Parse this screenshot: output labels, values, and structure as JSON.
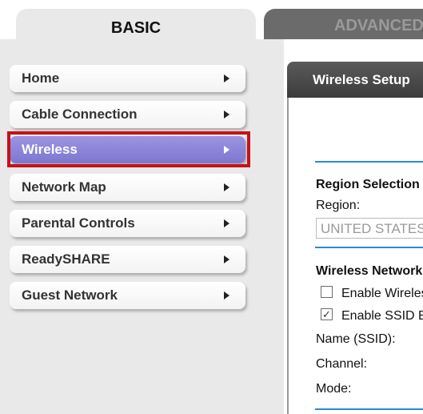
{
  "tabs": {
    "basic": "BASIC",
    "advanced": "ADVANCED"
  },
  "nav": [
    {
      "label": "Home"
    },
    {
      "label": "Cable Connection"
    },
    {
      "label": "Wireless"
    },
    {
      "label": "Network Map"
    },
    {
      "label": "Parental Controls"
    },
    {
      "label": "ReadySHARE"
    },
    {
      "label": "Guest Network"
    }
  ],
  "active_nav": "Wireless",
  "panel": {
    "title": "Wireless Setup",
    "region_section": "Region Selection",
    "region_label": "Region:",
    "region_value": "UNITED STATES",
    "network_section": "Wireless Network",
    "enable_wireless": {
      "label": "Enable Wireless",
      "checked": false
    },
    "enable_ssid": {
      "label": "Enable SSID Broadcast",
      "checked": true
    },
    "name_label": "Name (SSID):",
    "channel_label": "Channel:",
    "mode_label": "Mode:"
  },
  "colors": {
    "active": "#8a84da",
    "highlight": "#c8101a",
    "accent_line": "#2a8ad6"
  }
}
